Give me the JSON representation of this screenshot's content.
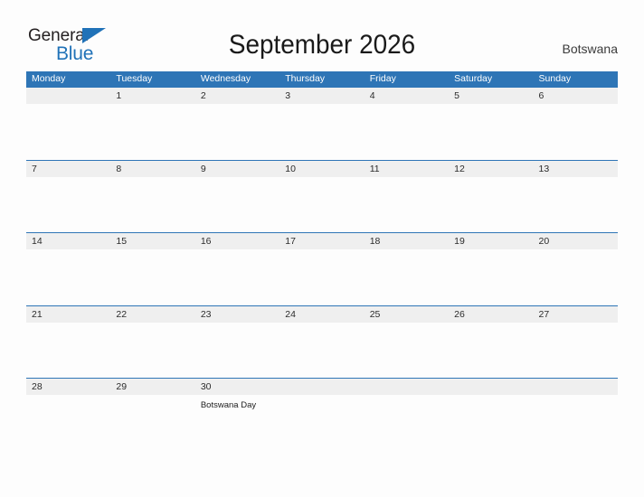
{
  "brand": {
    "name_part1": "General",
    "name_part2": "Blue",
    "flag_icon": "blue-flag-triangle",
    "color_primary": "#2072b8"
  },
  "header": {
    "title": "September 2026",
    "country": "Botswana"
  },
  "calendar": {
    "month": "September",
    "year": "2026",
    "accent_color": "#2e75b6",
    "band_color": "#efefef",
    "weekdays": [
      "Monday",
      "Tuesday",
      "Wednesday",
      "Thursday",
      "Friday",
      "Saturday",
      "Sunday"
    ],
    "weeks": [
      [
        {
          "num": "",
          "event": ""
        },
        {
          "num": "1",
          "event": ""
        },
        {
          "num": "2",
          "event": ""
        },
        {
          "num": "3",
          "event": ""
        },
        {
          "num": "4",
          "event": ""
        },
        {
          "num": "5",
          "event": ""
        },
        {
          "num": "6",
          "event": ""
        }
      ],
      [
        {
          "num": "7",
          "event": ""
        },
        {
          "num": "8",
          "event": ""
        },
        {
          "num": "9",
          "event": ""
        },
        {
          "num": "10",
          "event": ""
        },
        {
          "num": "11",
          "event": ""
        },
        {
          "num": "12",
          "event": ""
        },
        {
          "num": "13",
          "event": ""
        }
      ],
      [
        {
          "num": "14",
          "event": ""
        },
        {
          "num": "15",
          "event": ""
        },
        {
          "num": "16",
          "event": ""
        },
        {
          "num": "17",
          "event": ""
        },
        {
          "num": "18",
          "event": ""
        },
        {
          "num": "19",
          "event": ""
        },
        {
          "num": "20",
          "event": ""
        }
      ],
      [
        {
          "num": "21",
          "event": ""
        },
        {
          "num": "22",
          "event": ""
        },
        {
          "num": "23",
          "event": ""
        },
        {
          "num": "24",
          "event": ""
        },
        {
          "num": "25",
          "event": ""
        },
        {
          "num": "26",
          "event": ""
        },
        {
          "num": "27",
          "event": ""
        }
      ],
      [
        {
          "num": "28",
          "event": ""
        },
        {
          "num": "29",
          "event": ""
        },
        {
          "num": "30",
          "event": "Botswana Day"
        },
        {
          "num": "",
          "event": ""
        },
        {
          "num": "",
          "event": ""
        },
        {
          "num": "",
          "event": ""
        },
        {
          "num": "",
          "event": ""
        }
      ]
    ]
  }
}
